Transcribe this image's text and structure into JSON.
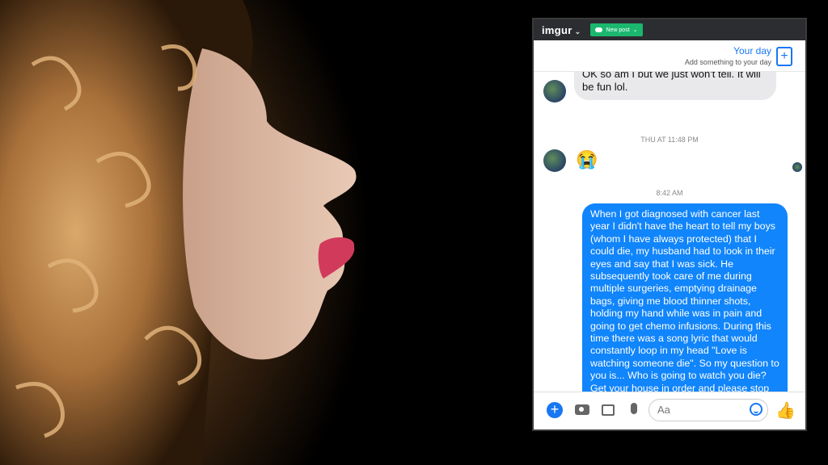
{
  "imgur": {
    "logo": "imgur",
    "new_post_label": "New post"
  },
  "your_day": {
    "title": "Your day",
    "subtitle": "Add something to your day"
  },
  "messages": {
    "received_1": "OK so am I but we just won't tell. It will be fun lol.",
    "timestamp_1": "THU AT 11:48 PM",
    "emoji": "😭",
    "timestamp_2": "8:42 AM",
    "sent_1": "When I got diagnosed with cancer last year I didn't have the heart to tell my boys (whom I have always protected) that I could die, my husband had to look in their eyes and say that I was sick. He subsequently took care of me during multiple surgeries, emptying drainage bags, giving me blood thinner shots, holding my hand while was in pain and going to get chemo infusions. During this time there was a song lyric that would constantly loop in my head \"Love is watching someone die\". So my question to you is... Who is going to watch you die? Get your house in order and please stop messaging me."
  },
  "input": {
    "placeholder": "Aa"
  },
  "icons": [
    "plus-icon",
    "camera-icon",
    "image-icon",
    "mic-icon",
    "smile-icon",
    "thumbs-up-icon"
  ],
  "colors": {
    "messenger_blue": "#1185fb",
    "imgur_green": "#1bb76e",
    "imgur_bar": "#2b2d31"
  }
}
